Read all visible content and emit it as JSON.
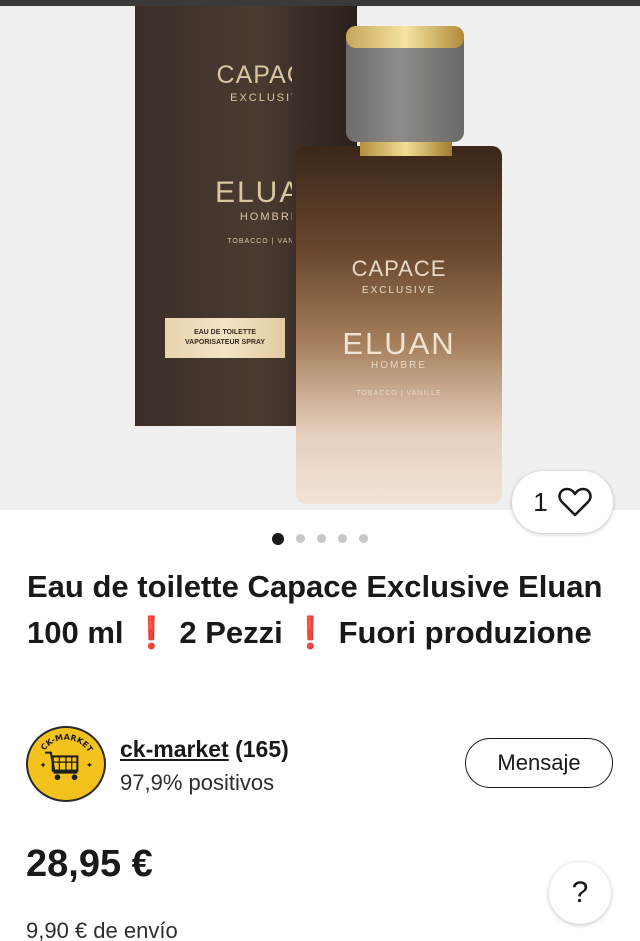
{
  "gallery": {
    "box": {
      "brand": "CAPACE",
      "brand_sub": "EXCLUSIVE",
      "name": "ELUAN",
      "name_sub": "HOMBRE",
      "notes": "TOBACCO | VANILLE",
      "label_line1": "EAU DE TOILETTE",
      "label_line2": "VAPORISATEUR SPRAY"
    },
    "bottle": {
      "brand": "CAPACE",
      "brand_sub": "EXCLUSIVE",
      "name": "ELUAN",
      "name_sub": "HOMBRE",
      "notes": "TOBACCO | VANILLE"
    },
    "like_count": "1",
    "heart_icon": "heart-outline-icon",
    "dots_total": 5,
    "dots_active": 1
  },
  "product": {
    "title": "Eau de toilette Capace Exclusive Eluan 100 ml ❗ 2 Pezzi ❗ Fuori produzione"
  },
  "seller": {
    "logo_text": "CK-MARKET",
    "name": "ck-market",
    "feedback_count": "(165)",
    "rating": "97,9% positivos",
    "message_label": "Mensaje"
  },
  "pricing": {
    "price": "28,95 €",
    "shipping": "9,90 € de envío"
  },
  "help": {
    "label": "?"
  },
  "colors": {
    "text": "#191919",
    "logo_yellow": "#f4c21c",
    "accent_red": "#e0201b"
  }
}
